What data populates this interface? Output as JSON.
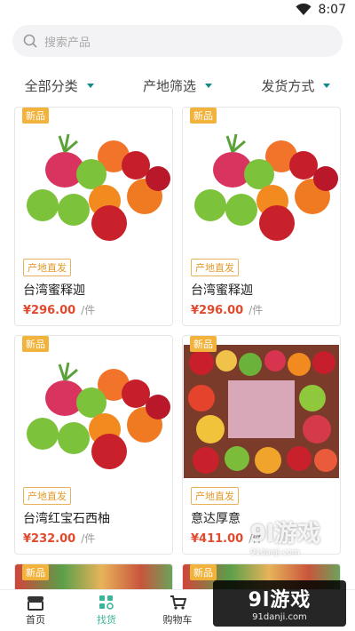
{
  "status": {
    "time": "8:07"
  },
  "search": {
    "placeholder": "搜索产品"
  },
  "filters": [
    {
      "label": "全部分类"
    },
    {
      "label": "产地筛选"
    },
    {
      "label": "发货方式"
    }
  ],
  "products": [
    {
      "tag": "新品",
      "origin": "产地直发",
      "name": "台湾蜜释迦",
      "price": "¥296.00",
      "unit": "/件"
    },
    {
      "tag": "新品",
      "origin": "产地直发",
      "name": "台湾蜜释迦",
      "price": "¥296.00",
      "unit": "/件"
    },
    {
      "tag": "新品",
      "origin": "产地直发",
      "name": "台湾红宝石西柚",
      "price": "¥232.00",
      "unit": "/件"
    },
    {
      "tag": "新品",
      "origin": "产地直发",
      "name": "意达厚意",
      "price": "¥411.00",
      "unit": "/件"
    }
  ],
  "partial_products": [
    {
      "tag": "新品"
    },
    {
      "tag": "新品"
    }
  ],
  "tabbar": [
    {
      "label": "首页",
      "icon": "store-icon"
    },
    {
      "label": "找货",
      "icon": "find-goods-icon"
    },
    {
      "label": "购物车",
      "icon": "cart-icon"
    }
  ],
  "watermark": {
    "big": "9l游戏",
    "small": "91danji.com"
  },
  "colors": {
    "accent": "#3bb59a",
    "price": "#e24a2e",
    "tag": "#f2b33d",
    "caret": "#138a8a"
  }
}
